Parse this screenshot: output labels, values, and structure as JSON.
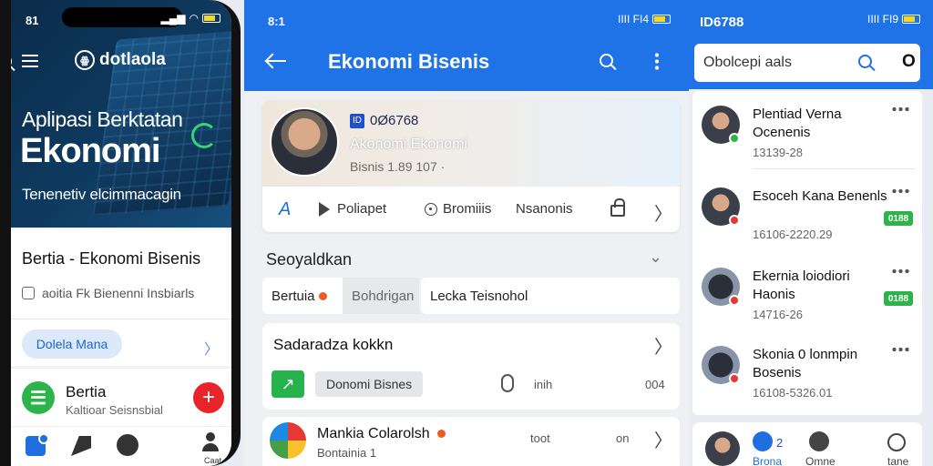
{
  "panel1": {
    "status_time": "81",
    "app_name": "dotlaola",
    "hero_line1": "Aplipasi Berktatan",
    "hero_line2": "Ekonomi",
    "hero_sub": "Tenenetiv elcimmacagin",
    "card_title": "Bertia - Ekonomi Bisenis",
    "card_meta": "aoitia Fk Bienenni Insbiarls",
    "chip_label": "Dolela Mana",
    "item_title": "Bertia",
    "item_sub": "Kaltioar Seisnsbial",
    "fab_label": "+",
    "nav_profile_label": "Caat"
  },
  "panel2": {
    "status_time": "8:1",
    "status_icons": "IIII FI4",
    "title": "Ekonomi Bisenis",
    "profile_id": "0Ø6768",
    "profile_id_badge": "ID",
    "profile_name": "Akonomi Ekonomi",
    "profile_stats": "Bisnis 1.89 107 ·",
    "action_a": "A",
    "action_play": "Poliapet",
    "action_circle": "Bromiiis",
    "action_text": "Nsanonis",
    "section_title": "Seoyaldkan",
    "tabs": [
      "Bertuia",
      "Bohdrigan",
      "Lecka Teisnohol"
    ],
    "box_title": "Sadaradza kokkn",
    "box_pill": "Donomi Bisnes",
    "box_t1": "inih",
    "box_t2": "004",
    "list_title": "Mankia Colarolsh",
    "list_sub": "Bontainia",
    "list_sub_num": "1",
    "list_t1": "toot",
    "list_t2": "on"
  },
  "panel3": {
    "status_id": "ID6788",
    "status_icons": "IIII FI9",
    "search_placeholder": "Obolcepi aals",
    "search_o": "O",
    "chats": [
      {
        "name": "Plentiad Verna Ocenenis",
        "meta": "13139-28",
        "badge_color": "#2db34a",
        "pill": ""
      },
      {
        "name": "Esoceh Kana Benenls",
        "meta": "16106-2220.29",
        "badge_color": "#e53935",
        "pill": "0188"
      },
      {
        "name": "Ekernia loiodiori Haonis",
        "meta": "14716-26",
        "badge_color": "#e53935",
        "pill": "0188"
      },
      {
        "name": "Skonia 0 lonmpin Bosenis",
        "meta": "16108-5326.01",
        "badge_color": "#e53935",
        "pill": ""
      }
    ],
    "nav_count": "2",
    "nav_chat_label": "Brona",
    "nav_gear_label": "Omne",
    "nav_clock_label": "tane"
  }
}
